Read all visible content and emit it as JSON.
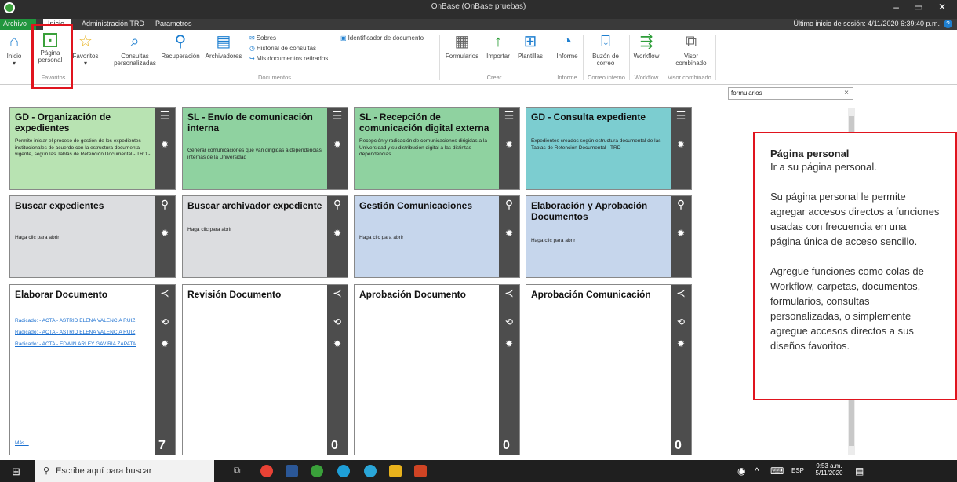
{
  "window": {
    "title": "OnBase (OnBase pruebas)",
    "controls": "– ▭ ✕"
  },
  "menu": {
    "tabs": [
      "Archivo",
      "Inicio",
      "Administración TRD",
      "Parametros"
    ],
    "last_login": "Último inicio de sesión: 4/11/2020 6:39:40 p.m.",
    "help": "?"
  },
  "ribbon": {
    "buttons": {
      "inicio": "Inicio",
      "pagina_personal": "Página personal",
      "favoritos": "Favoritos",
      "consultas": "Consultas personalizadas",
      "recuperacion": "Recuperación",
      "archivadores": "Archivadores",
      "sobres": "Sobres",
      "historial": "Historial de consultas",
      "retirados": "Mis documentos retirados",
      "identificador": "Identificador de documento",
      "formularios": "Formularios",
      "importar": "Importar",
      "plantillas": "Plantillas",
      "informe": "Informe",
      "buzon": "Buzón de correo",
      "workflow": "Workflow",
      "visor": "Visor combinado"
    },
    "groups": [
      "Favoritos",
      "Documentos",
      "Crear",
      "Informe",
      "Correo interno",
      "Workflow",
      "Visor combinado"
    ]
  },
  "search": {
    "value": "formularios",
    "clear": "×"
  },
  "tiles": [
    {
      "title": "GD - Organización de expedientes",
      "desc": "Permite iniciar el proceso de gestión de los expedientes institucionales de acuerdo con la estructura documental vigente, según las Tablas de Retención Documental - TRD -"
    },
    {
      "title": "SL - Envío de comunicación interna",
      "desc": "Generar comunicaciones que van dirigidas a dependencias internas de la Universidad"
    },
    {
      "title": "SL - Recepción de comunicación digital externa",
      "desc": "Recepción y radicación de comunicaciones dirigidas a la Universidad y su distribución digital a las distintas dependencias."
    },
    {
      "title": "GD - Consulta expediente",
      "desc": "Expedientes creados según estructura documental de las Tablas de Retención Documental - TRD"
    },
    {
      "title": "Buscar expedientes",
      "desc": "Haga clic para abrir"
    },
    {
      "title": "Buscar archivador expediente",
      "desc": "Haga clic para abrir"
    },
    {
      "title": "Gestión Comunicaciones",
      "desc": "Haga clic para abrir"
    },
    {
      "title": "Elaboración y Aprobación Documentos",
      "desc": "Haga clic para abrir"
    },
    {
      "title": "Elaborar Documento",
      "count": "7",
      "more": "Más...",
      "items": [
        "Radicado: - ACTA - ASTRID ELENA VALENCIA RUIZ",
        "Radicado: - ACTA - ASTRID ELENA VALENCIA RUIZ",
        "Radicado: - ACTA - EDWIN ARLEY GAVIRIA ZAPATA"
      ]
    },
    {
      "title": "Revisión Documento",
      "count": "0"
    },
    {
      "title": "Aprobación Documento",
      "count": "0"
    },
    {
      "title": "Aprobación Comunicación",
      "count": "0"
    }
  ],
  "tooltip": {
    "title": "Página personal",
    "line1": "Ir a su página personal.",
    "para2": "Su página personal le permite agregar accesos directos a funciones usadas con frecuencia en una página única de acceso sencillo.",
    "para3": "Agregue funciones como colas de Workflow, carpetas, documentos, formularios, consultas personalizadas, o simplemente agregue accesos directos a sus diseños favoritos."
  },
  "taskbar": {
    "search_placeholder": "Escribe aquí para buscar",
    "lang": "ESP",
    "time": "9:53 a.m.",
    "date": "5/11/2020"
  },
  "colors": {
    "accent": "#1e7fd0",
    "highlight": "#e0141e",
    "archivo_tab": "#21963e"
  }
}
